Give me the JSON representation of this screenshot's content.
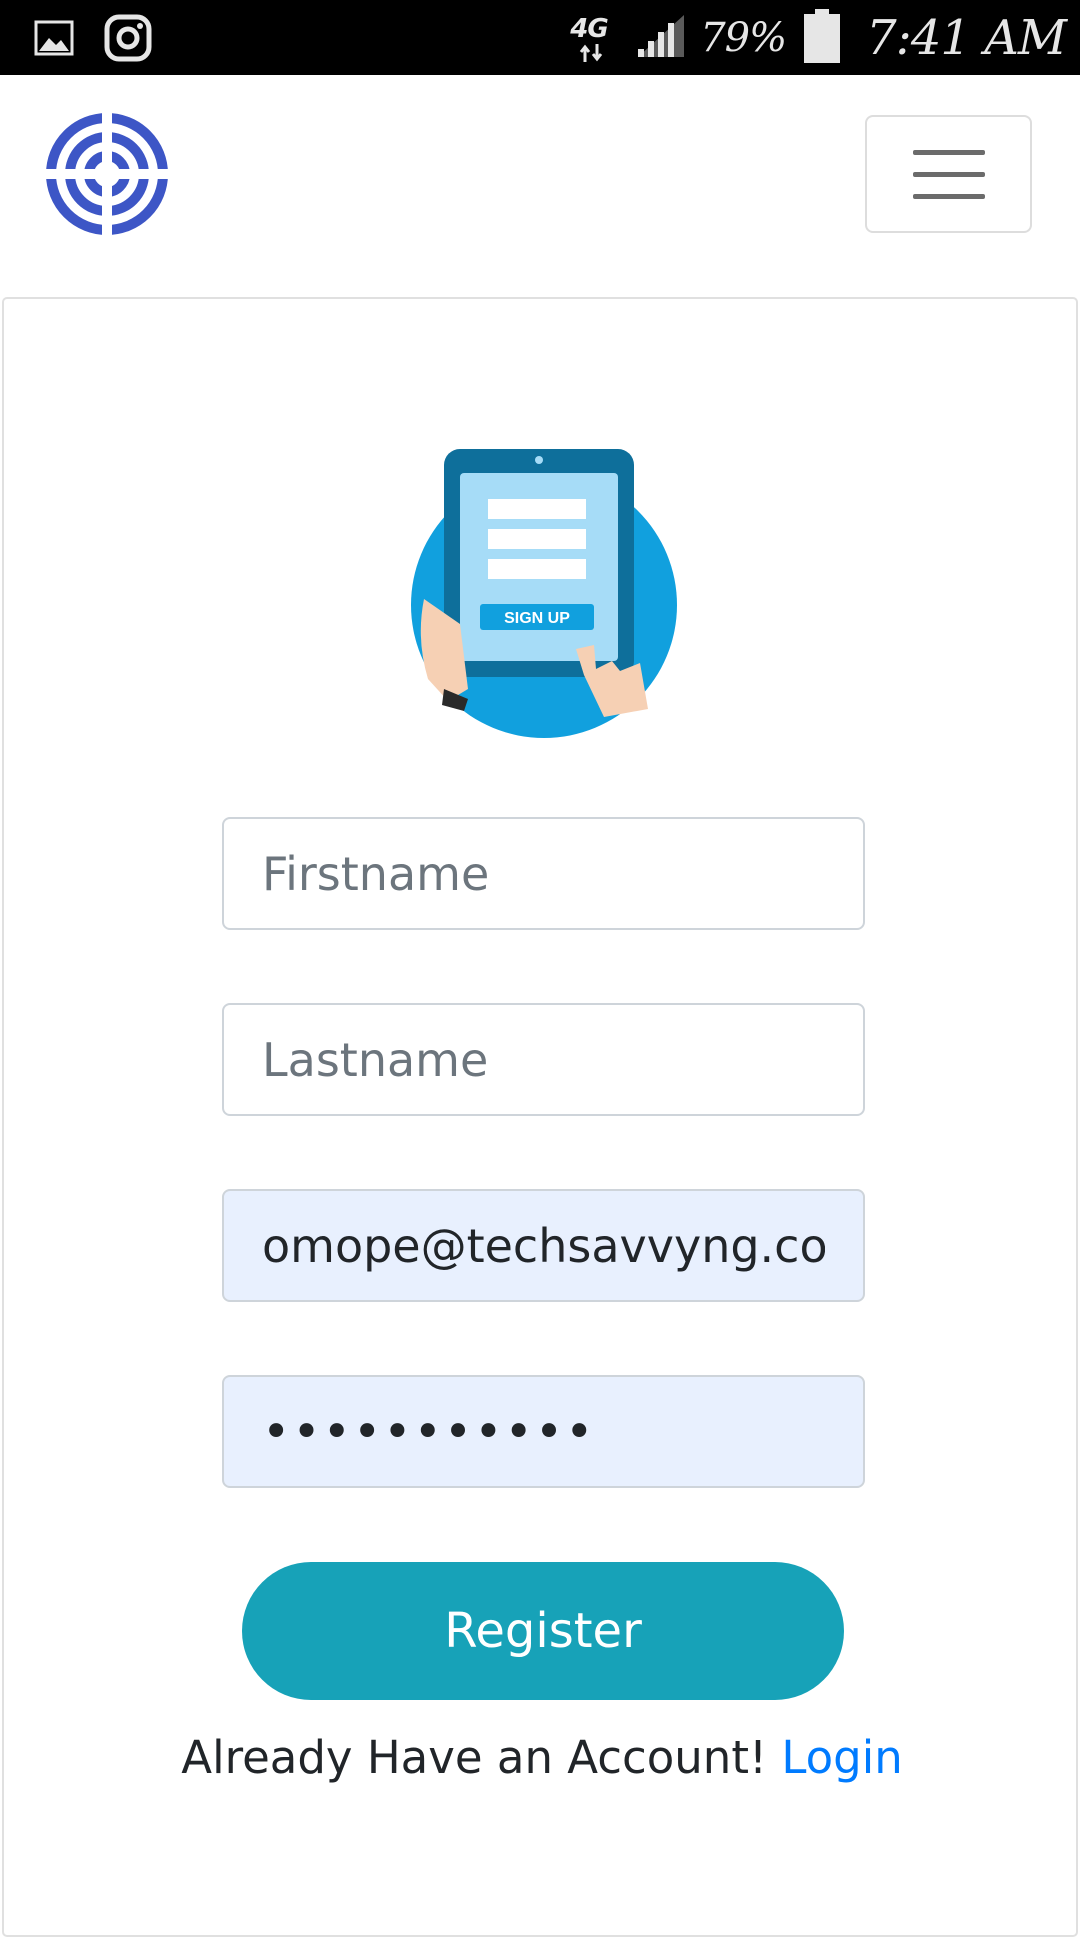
{
  "status_bar": {
    "network_type": "4G",
    "battery_percent": "79%",
    "time": "7:41 AM",
    "left_icons": [
      "gallery-icon",
      "instagram-icon"
    ],
    "right_icons": [
      "signal-icon",
      "battery-icon"
    ]
  },
  "navbar": {
    "logo_icon": "target-logo-icon",
    "menu_icon": "hamburger-menu-icon",
    "logo_color": "#3d56c6"
  },
  "form": {
    "illustration": {
      "icon": "signup-tablet-illustration",
      "button_text": "SIGN UP"
    },
    "firstname_placeholder": "Firstname",
    "lastname_placeholder": "Lastname",
    "email_value": "omope@techsavvyng.com",
    "password_value": "•••••••••••",
    "register_label": "Register",
    "account_prompt": "Already Have an Account! ",
    "login_link": "Login"
  },
  "colors": {
    "accent": "#17a2b8",
    "link": "#007bff",
    "autofill_bg": "#e8f0fe"
  }
}
